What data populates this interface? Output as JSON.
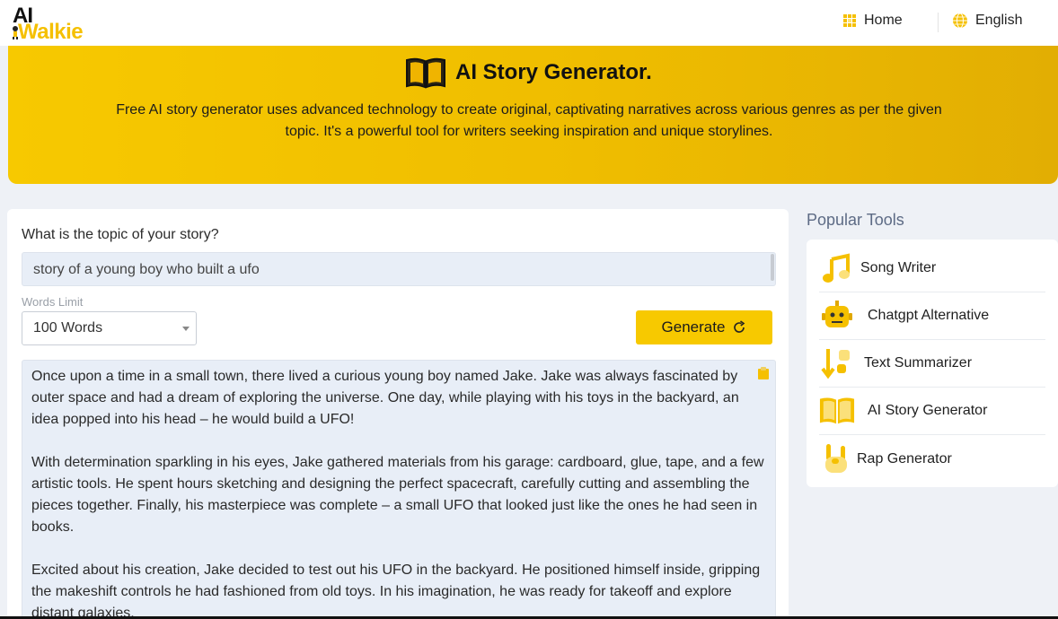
{
  "brand": {
    "logo_ai": "AI",
    "logo_walkie": "Walkie"
  },
  "nav": {
    "home": "Home",
    "language": "English"
  },
  "hero": {
    "title": "AI Story Generator.",
    "description": "Free AI story generator uses advanced technology to create original, captivating narratives across various genres as per the given topic. It's a powerful tool for writers seeking inspiration and unique storylines."
  },
  "form": {
    "topic_label": "What is the topic of your story?",
    "topic_value": "story of a young boy who built a ufo",
    "words_limit_label": "Words Limit",
    "words_limit_value": "100 Words",
    "generate_label": "Generate"
  },
  "output": {
    "paragraphs": [
      "Once upon a time in a small town, there lived a curious young boy named Jake. Jake was always fascinated by outer space and had a dream of exploring the universe. One day, while playing with his toys in the backyard, an idea popped into his head – he would build a UFO!",
      "With determination sparkling in his eyes, Jake gathered materials from his garage: cardboard, glue, tape, and a few artistic tools. He spent hours sketching and designing the perfect spacecraft, carefully cutting and assembling the pieces together. Finally, his masterpiece was complete – a small UFO that looked just like the ones he had seen in books.",
      "Excited about his creation, Jake decided to test out his UFO in the backyard. He positioned himself inside, gripping the makeshift controls he had fashioned from old toys. In his imagination, he was ready for takeoff and explore distant galaxies."
    ]
  },
  "sidebar": {
    "title": "Popular Tools",
    "items": [
      {
        "label": "Song Writer",
        "icon": "music-note-icon"
      },
      {
        "label": "Chatgpt Alternative",
        "icon": "robot-icon"
      },
      {
        "label": "Text Summarizer",
        "icon": "summarize-icon"
      },
      {
        "label": "AI Story Generator",
        "icon": "book-icon"
      },
      {
        "label": "Rap Generator",
        "icon": "rock-hand-icon"
      }
    ]
  },
  "colors": {
    "accent": "#f7c900",
    "input_bg": "#e8eef7",
    "page_bg": "#eef1f6"
  }
}
